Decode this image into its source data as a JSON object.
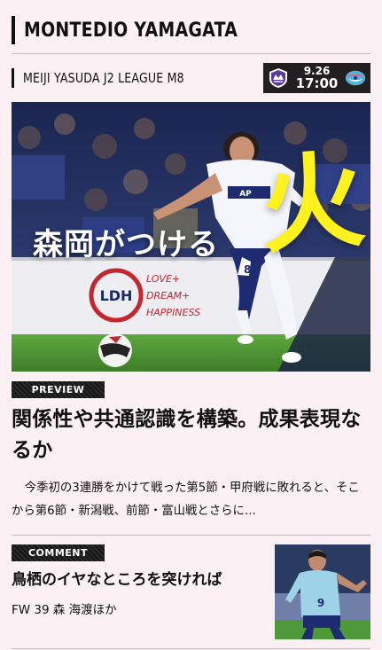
{
  "team": {
    "name": "MONTEDIO YAMAGATA"
  },
  "match": {
    "league": "MEIJI YASUDA J2 LEAGUE M8",
    "date": "9.26",
    "time": "17:00",
    "home_crest": "montedio-crest-icon",
    "away_crest": "sagan-crest-icon"
  },
  "hero": {
    "overlay_text": "森岡がつける",
    "overlay_big": "火",
    "big_color": "#fff21f",
    "board_text": "LOVE+ DREAM+ HAPPINESS",
    "board_logo": "LDH",
    "shirt_number": "8",
    "shirt_sponsor": "AP"
  },
  "preview_article": {
    "badge": "PREVIEW",
    "headline": "関係性や共通認識を構築。成果表現なるか",
    "excerpt": "今季初の3連勝をかけて戦った第5節・甲府戦に敗れると、そこから第6節・新潟戦、前節・富山戦とさらに..."
  },
  "comment_article": {
    "badge": "COMMENT",
    "title": "鳥栖のイヤなところを突ければ",
    "subtitle": "FW 39 森 海渡ほか",
    "thumb_number": "9"
  },
  "colors": {
    "background": "#fbf0f4",
    "text": "#111111",
    "badge": "#1b1b1b",
    "accent_yellow": "#fff21f",
    "divider": "#c9bcc2"
  }
}
